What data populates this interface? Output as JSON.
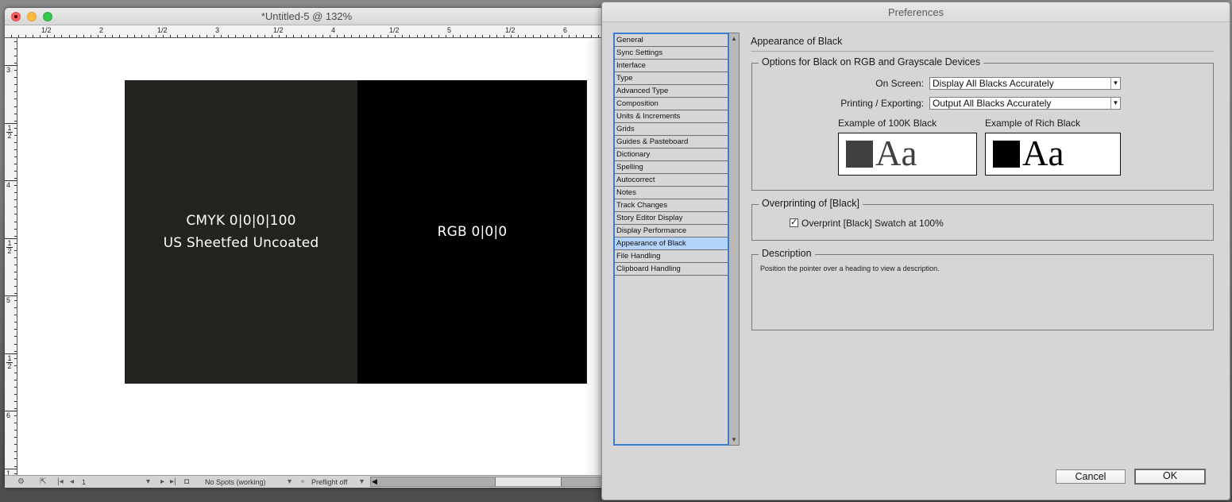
{
  "document_window": {
    "title": "*Untitled-5 @ 132%",
    "horizontal_ruler_labels": [
      "1/2",
      "2",
      "1/2",
      "3",
      "1/2",
      "4",
      "1/2",
      "5",
      "1/2",
      "6"
    ],
    "vertical_ruler_labels": [
      "3",
      "1/2",
      "4",
      "1/2",
      "5",
      "1/2",
      "6",
      "1"
    ],
    "canvas": {
      "swatch_cmyk": {
        "line1": "CMYK 0|0|0|100",
        "line2": "US Sheetfed Uncoated",
        "color": "#232420"
      },
      "swatch_rgb": {
        "line1": "RGB 0|0|0",
        "color": "#000000"
      }
    },
    "status_bar": {
      "page_number": "1",
      "spots_label": "No Spots (working)",
      "preflight_label": "Preflight off"
    }
  },
  "preferences_dialog": {
    "title": "Preferences",
    "categories": [
      {
        "label": "General",
        "selected": false
      },
      {
        "label": "Sync Settings",
        "selected": false
      },
      {
        "label": "Interface",
        "selected": false
      },
      {
        "label": "Type",
        "selected": false
      },
      {
        "label": "Advanced Type",
        "selected": false
      },
      {
        "label": "Composition",
        "selected": false
      },
      {
        "label": "Units & Increments",
        "selected": false
      },
      {
        "label": "Grids",
        "selected": false
      },
      {
        "label": "Guides & Pasteboard",
        "selected": false
      },
      {
        "label": "Dictionary",
        "selected": false
      },
      {
        "label": "Spelling",
        "selected": false
      },
      {
        "label": "Autocorrect",
        "selected": false
      },
      {
        "label": "Notes",
        "selected": false
      },
      {
        "label": "Track Changes",
        "selected": false
      },
      {
        "label": "Story Editor Display",
        "selected": false
      },
      {
        "label": "Display Performance",
        "selected": false
      },
      {
        "label": "Appearance of Black",
        "selected": true
      },
      {
        "label": "File Handling",
        "selected": false
      },
      {
        "label": "Clipboard Handling",
        "selected": false
      }
    ],
    "section_title": "Appearance of Black",
    "options_group": {
      "legend": "Options for Black on RGB and Grayscale Devices",
      "on_screen_label": "On Screen:",
      "on_screen_value": "Display All Blacks Accurately",
      "printing_label": "Printing / Exporting:",
      "printing_value": "Output All Blacks Accurately",
      "example_100k_label": "Example of 100K Black",
      "example_100k_color": "#404040",
      "example_rich_label": "Example of Rich Black",
      "example_rich_color": "#000000",
      "example_text": "Aa"
    },
    "overprint_group": {
      "legend": "Overprinting of [Black]",
      "checkbox_label": "Overprint [Black] Swatch at 100%",
      "checked": true,
      "check_glyph": "✓"
    },
    "description_group": {
      "legend": "Description",
      "text": "Position the pointer over a heading to view a description."
    },
    "buttons": {
      "cancel": "Cancel",
      "ok": "OK"
    },
    "accent_color": "#3d7bd0",
    "selection_color": "#b4d3fb"
  }
}
